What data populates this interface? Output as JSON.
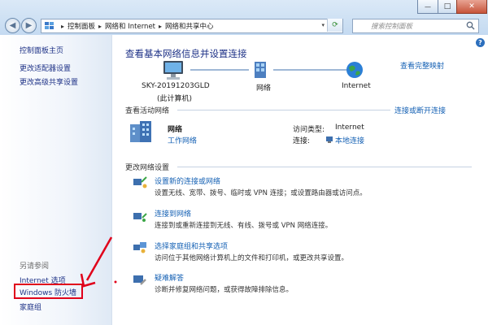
{
  "window": {
    "controls": {
      "minimize": "—",
      "maximize": "□",
      "close": "✕"
    }
  },
  "addressbar": {
    "crumbs": [
      "控制面板",
      "网络和 Internet",
      "网络和共享中心"
    ],
    "search_placeholder": "搜索控制面板"
  },
  "sidebar": {
    "items": [
      {
        "label": "控制面板主页"
      },
      {
        "label": "更改适配器设置"
      },
      {
        "label": "更改高级共享设置"
      }
    ],
    "see_also_heading": "另请参阅",
    "see_also": [
      {
        "label": "Internet 选项"
      },
      {
        "label": "Windows 防火墙"
      },
      {
        "label": "家庭组"
      }
    ]
  },
  "main": {
    "title": "查看基本网络信息并设置连接",
    "view_full_map": "查看完整映射",
    "map": {
      "computer": "SKY-20191203GLD",
      "computer_sub": "(此计算机)",
      "network": "网络",
      "internet": "Internet"
    },
    "active_networks": {
      "heading": "查看活动网络",
      "connect_link": "连接或断开连接",
      "network_name": "网络",
      "network_type": "工作网络",
      "access_type_label": "访问类型:",
      "access_type_value": "Internet",
      "connections_label": "连接:",
      "connections_value": "本地连接"
    },
    "change_settings": {
      "heading": "更改网络设置",
      "tasks": [
        {
          "title": "设置新的连接或网络",
          "desc": "设置无线、宽带、拨号、临时或 VPN 连接；或设置路由器或访问点。"
        },
        {
          "title": "连接到网络",
          "desc": "连接到或重新连接到无线、有线、拨号或 VPN 网络连接。"
        },
        {
          "title": "选择家庭组和共享选项",
          "desc": "访问位于其他网络计算机上的文件和打印机，或更改共享设置。"
        },
        {
          "title": "疑难解答",
          "desc": "诊断并修复网络问题，或获得故障排除信息。"
        }
      ]
    }
  },
  "colors": {
    "link": "#1561b4",
    "highlight_box": "#e0001a",
    "annotation_arrow": "#e0001a"
  }
}
